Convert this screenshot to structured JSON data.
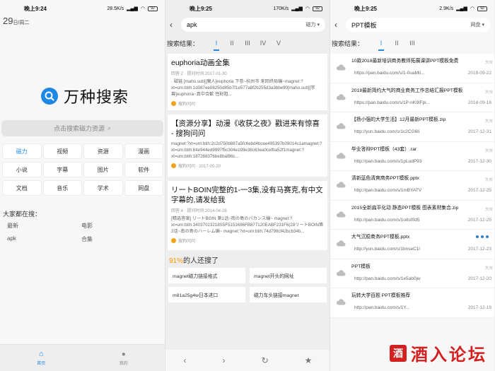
{
  "screen1": {
    "status": {
      "time": "晚上9:24",
      "speed": "28.5K/s",
      "battery": "92"
    },
    "date": "29",
    "date_sub": "日/周二",
    "logo_text": "万种搜索",
    "search_placeholder": "点击搜索磁力资源",
    "categories": [
      "磁力",
      "视频",
      "资源",
      "漫画",
      "小说",
      "字幕",
      "图片",
      "软件",
      "文档",
      "音乐",
      "学术",
      "网盘"
    ],
    "popular_title": "大家都在搜：",
    "popular": [
      "最新",
      "电影",
      "apk",
      "合集"
    ],
    "nav": [
      "首页",
      "我的"
    ]
  },
  "screen2": {
    "status": {
      "time": "晚上9:25",
      "speed": "170K/s",
      "battery": "92"
    },
    "query": "apk",
    "filter": "磁力",
    "results_label": "搜索结果：",
    "pages": [
      "I",
      "II",
      "III",
      "IV",
      "V"
    ],
    "results": [
      {
        "title": "euphoria动画全集",
        "meta": "回答:2 · 提问时间:2017-01-30",
        "snippet": "· 磁链 [maho.sub][魔人]euphoria 下卷~杭州市 来回终局编~magnet:?xt=urn:btih:1d087ee08250d85b7f1e577a8f2b255d3a3bbe90[maho.sub][字幕]euphoria~真中合歓 性財阻...",
        "source": "搜狗问问"
      },
      {
        "title": "【资源分享】动漫《收获之夜》戳进来有惊喜 - 搜狗问问",
        "meta": "",
        "snippet": "magnet:?xt=urn:btih:2c2d750b887a5fc6ebd4bcee495397b09014c1amagnet:?xt=urn:btih:84e944ed9997f5c304e199e38c63ea0cefba52f1magnet:?xt=urn:btih:187268376be8baf86c...",
        "source": "搜狗问问 · 2017-05-20"
      },
      {
        "title": "リートBOIN完整的1-一3集,没有马赛克,有中文字幕的,请发给我",
        "meta": "回答:4 · 提问时间:2014-04-26",
        "snippet": "[精选答案] リートBOIN 第1话~南の島のバカンス编~ magnet:?xt=urn:btih:34037023218S5F5151686FB877120EABF231F6(28リートBOIN第2话~南の島のハーレム编~ magnet:?xt=urn:btih:74d798cf42bcb34b...",
        "source": "搜狗问问"
      }
    ],
    "pct_num": "91%",
    "pct_text": "的人还搜了",
    "related": [
      "magnet磁力链接格式",
      "magnet开头的网址",
      "m81a25g4w日本进口",
      "磁力车头链接magnet"
    ]
  },
  "screen3": {
    "status": {
      "time": "晚上9:25",
      "speed": "2.9K/s",
      "battery": "92"
    },
    "query": "PPT模板",
    "filter": "网盘",
    "results_label": "搜索结果：",
    "pages": [
      "I",
      "II",
      "III"
    ],
    "rows": [
      {
        "title": "10款2018最新培训商务教师拓展课讲PPT模板免费",
        "url": "https://pan.baidu.com/s/1-0uaMil...",
        "date": "2018-09-22",
        "tag": "失效"
      },
      {
        "title": "2018最新简约大气的商业商务工作总结汇报PPT模板",
        "url": "https://pan.baidu.com/s/1P-nK9IFpi...",
        "date": "2018-09-16",
        "tag": "失效"
      },
      {
        "title": "【扬小强的大学生活】12月最新PPT模板.zip",
        "url": "http://yun.baidu.com/s/1c2CG6li",
        "date": "2017-12-31",
        "tag": "失效"
      },
      {
        "title": "毕业答辩PPT模板（43套）.rar",
        "url": "http://pan.baidu.com/s/1pLudP93",
        "date": "2017-12-30",
        "tag": "失效"
      },
      {
        "title": "清新蓝色清爽商务PPT模板.pptx",
        "url": "http://pan.baidu.com/s/1mBYATV",
        "date": "2017-12-25",
        "tag": "失效"
      },
      {
        "title": "2015全新扁平化动 静态PPT模板 图表素材集合.zip",
        "url": "http://pan.baidu.com/s/1o8sf0d5",
        "date": "2017-12-25",
        "tag": "失效"
      },
      {
        "title": "大气沉稳商务PPT模板.pptx",
        "url": "http://yun.baidu.com/s/1bnseC1l",
        "date": "2017-12-23",
        "tag": ""
      },
      {
        "title": "PPT模板",
        "url": "http://pan.baidu.com/s/1e5ab0jw",
        "date": "2017-12-20",
        "tag": "失效"
      },
      {
        "title": "玩转大学百题 PPT模板推荐",
        "url": "http://pan.baidu.com/s/1Y...",
        "date": "2017-12-19",
        "tag": ""
      }
    ],
    "watermark": "酒入论坛"
  },
  "colors": {
    "accent": "#1e88e5",
    "orange": "#ff9800",
    "red": "#e53935",
    "watermark": "#d32020"
  }
}
